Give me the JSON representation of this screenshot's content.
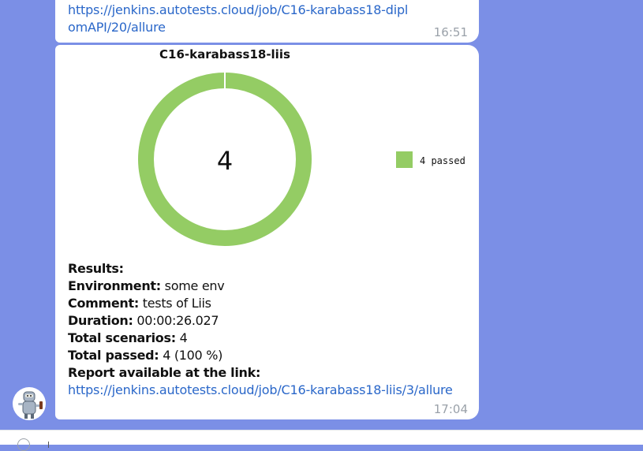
{
  "messages": [
    {
      "link": "https://jenkins.autotests.cloud/job/C16-karabass18-diplomAPI/20/allure",
      "time": "16:51"
    },
    {
      "chart_title": "C16-karabass18-liis",
      "results_label": "Results:",
      "environment_label": "Environment:",
      "environment_value": "some env",
      "comment_label": "Comment:",
      "comment_value": "tests of Liis",
      "duration_label": "Duration:",
      "duration_value": "00:00:26.027",
      "total_scenarios_label": "Total scenarios:",
      "total_scenarios_value": "4",
      "total_passed_label": "Total passed:",
      "total_passed_value": "4 (100 %)",
      "report_label": "Report available at the link:",
      "link": "https://jenkins.autotests.cloud/job/C16-karabass18-liis/3/allure",
      "time": "17:04"
    }
  ],
  "chart_data": {
    "type": "pie",
    "title": "C16-karabass18-liis",
    "center_label": "4",
    "slices": [
      {
        "name": "4 passed",
        "value": 4,
        "color": "#94cc64"
      }
    ]
  },
  "colors": {
    "background": "#7b8fe6",
    "link": "#2a67c9",
    "passed": "#94cc64"
  },
  "icons": {
    "avatar": "robot-avatar-icon",
    "attach": "paperclip-icon"
  }
}
